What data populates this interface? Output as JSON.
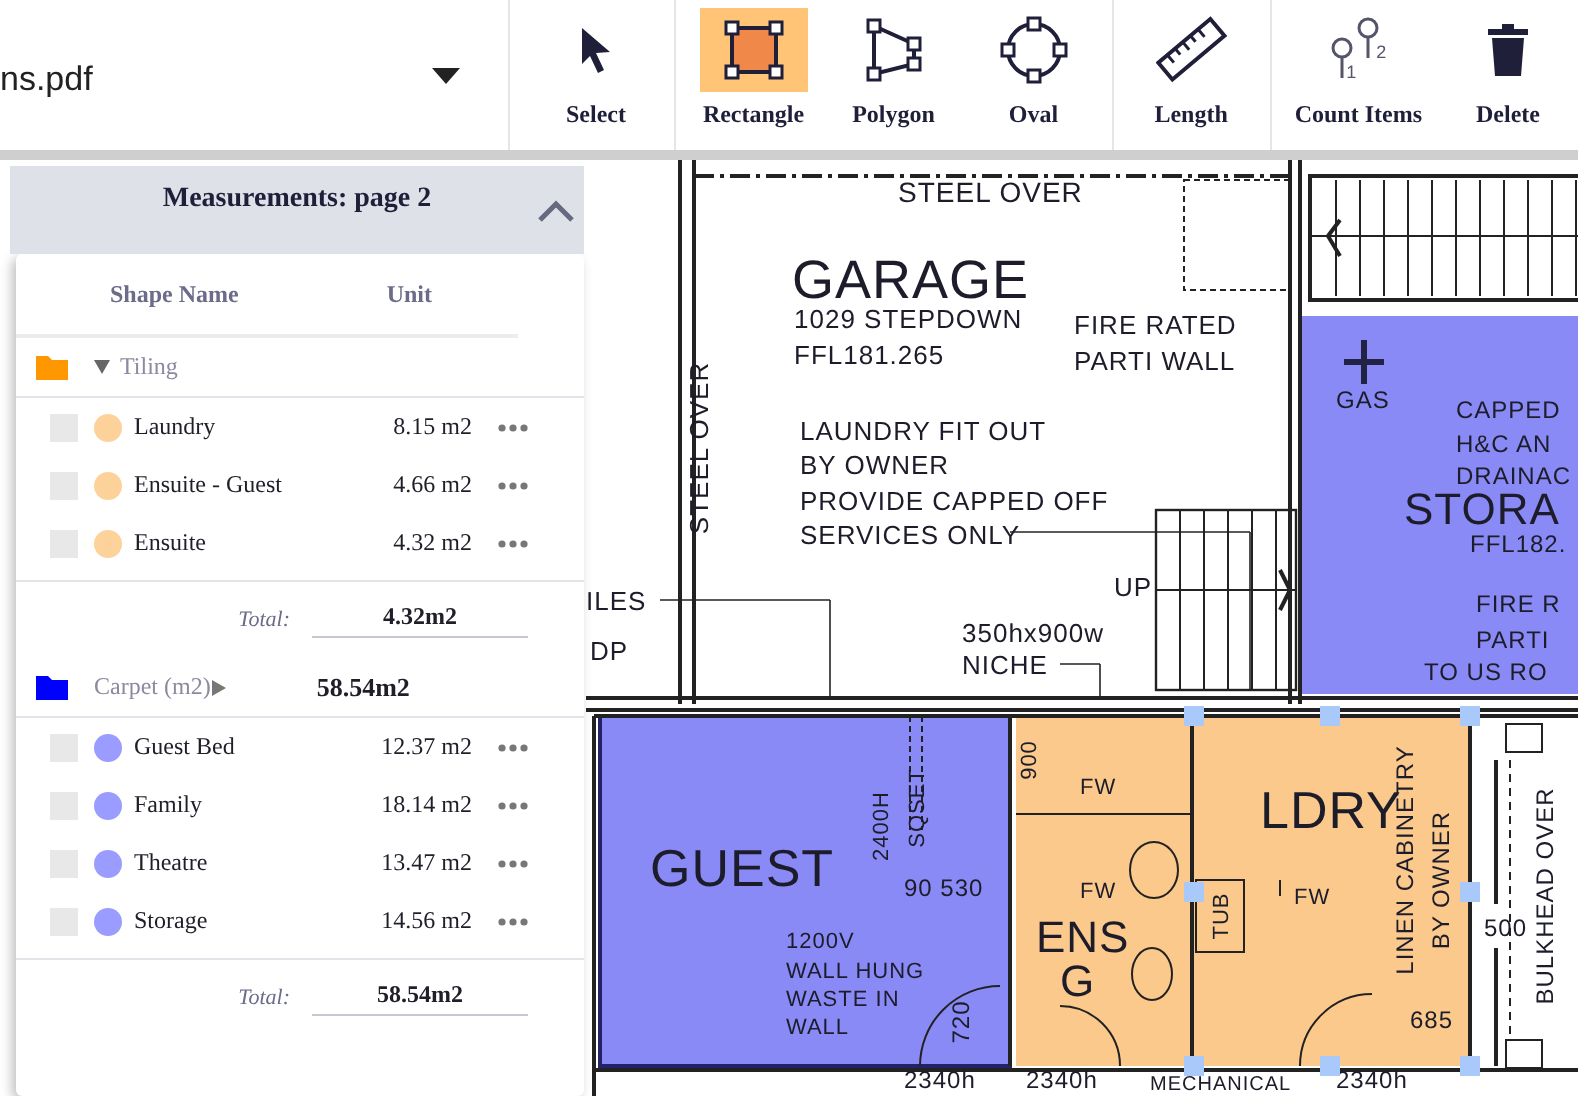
{
  "toolbar": {
    "file": {
      "name": "ns.pdf"
    },
    "tools": [
      {
        "kind": "select",
        "label": "Select",
        "selected": false
      },
      {
        "kind": "rectangle",
        "label": "Rectangle",
        "selected": true
      },
      {
        "kind": "polygon",
        "label": "Polygon",
        "selected": false
      },
      {
        "kind": "oval",
        "label": "Oval",
        "selected": false
      },
      {
        "kind": "length",
        "label": "Length",
        "selected": false
      },
      {
        "kind": "count",
        "label": "Count Items",
        "selected": false,
        "marks": [
          "1",
          "2"
        ]
      },
      {
        "kind": "delete",
        "label": "Delete",
        "selected": false
      }
    ]
  },
  "panel": {
    "title": "Measurements: page 2",
    "expanded": true,
    "columns": [
      "Shape Name",
      "Unit"
    ],
    "groups": [
      {
        "name": "Tiling",
        "color": "#ff9800",
        "expanded": true,
        "items": [
          {
            "name": "Laundry",
            "area": "8.15 m2",
            "color": "#fdd29a",
            "checked": false
          },
          {
            "name": "Ensuite - Guest",
            "area": "4.66 m2",
            "color": "#fdd29a",
            "checked": false
          },
          {
            "name": "Ensuite",
            "area": "4.32 m2",
            "color": "#fdd29a",
            "checked": false
          }
        ],
        "total_label": "Total:",
        "total": "4.32m2"
      },
      {
        "name": "Carpet (m2)",
        "color": "#0000ff",
        "expanded": false,
        "header_total": "58.54m2",
        "items": [
          {
            "name": "Guest Bed",
            "area": "12.37 m2",
            "color": "#9a9cff",
            "checked": false
          },
          {
            "name": "Family",
            "area": "18.14 m2",
            "color": "#9a9cff",
            "checked": false
          },
          {
            "name": "Theatre",
            "area": "13.47 m2",
            "color": "#9a9cff",
            "checked": false
          },
          {
            "name": "Storage",
            "area": "14.56 m2",
            "color": "#9a9cff",
            "checked": false
          }
        ],
        "total_label": "Total:",
        "total": "58.54m2"
      }
    ]
  },
  "plan": {
    "labels": [
      {
        "text": "STEEL OVER",
        "vertical": false
      },
      {
        "text": "GARAGE",
        "vertical": false
      },
      {
        "text": "1029 STEPDOWN",
        "vertical": false
      },
      {
        "text": "FFL181.265",
        "vertical": false
      },
      {
        "text": "FIRE RATED",
        "vertical": false
      },
      {
        "text": "PARTI WALL",
        "vertical": false
      },
      {
        "text": "STEEL OVER",
        "vertical": true
      },
      {
        "text": "LAUNDRY FIT OUT",
        "vertical": false
      },
      {
        "text": "BY OWNER",
        "vertical": false
      },
      {
        "text": "PROVIDE CAPPED OFF",
        "vertical": false
      },
      {
        "text": "SERVICES ONLY",
        "vertical": false
      },
      {
        "text": "UP",
        "vertical": false
      },
      {
        "text": "350hx900w",
        "vertical": false
      },
      {
        "text": "NICHE",
        "vertical": false
      },
      {
        "text": "ILES",
        "vertical": false
      },
      {
        "text": "DP",
        "vertical": false
      },
      {
        "text": "GAS",
        "vertical": false
      },
      {
        "text": "CAPPED",
        "vertical": false
      },
      {
        "text": "H&C AN",
        "vertical": false
      },
      {
        "text": "DRAINAC",
        "vertical": false
      },
      {
        "text": "STORA",
        "vertical": false
      },
      {
        "text": "FFL182.",
        "vertical": false
      },
      {
        "text": "FIRE R",
        "vertical": false
      },
      {
        "text": "PARTI",
        "vertical": false
      },
      {
        "text": "TO US RO",
        "vertical": false
      },
      {
        "text": "GUEST",
        "vertical": false
      },
      {
        "text": "2400H",
        "vertical": true
      },
      {
        "text": "SQSET",
        "vertical": true
      },
      {
        "text": "90 530",
        "vertical": false
      },
      {
        "text": "1200V",
        "vertical": false
      },
      {
        "text": "WALL HUNG",
        "vertical": false
      },
      {
        "text": "WASTE IN",
        "vertical": false
      },
      {
        "text": "WALL",
        "vertical": false
      },
      {
        "text": "720",
        "vertical": true
      },
      {
        "text": "900",
        "vertical": true
      },
      {
        "text": "FW",
        "vertical": false
      },
      {
        "text": "FW",
        "vertical": false
      },
      {
        "text": "ENS",
        "vertical": false
      },
      {
        "text": "G",
        "vertical": false
      },
      {
        "text": "LDRY",
        "vertical": false
      },
      {
        "text": "FW",
        "vertical": false
      },
      {
        "text": "TUB",
        "vertical": true
      },
      {
        "text": "LINEN CABINETRY",
        "vertical": true
      },
      {
        "text": "BY OWNER",
        "vertical": true
      },
      {
        "text": "500",
        "vertical": false
      },
      {
        "text": "685",
        "vertical": false
      },
      {
        "text": "BULKHEAD OVER",
        "vertical": true
      },
      {
        "text": "2340h",
        "vertical": false
      },
      {
        "text": "2340h",
        "vertical": false
      },
      {
        "text": "MECHANICAL",
        "vertical": false
      },
      {
        "text": "2340h",
        "vertical": false
      }
    ]
  }
}
